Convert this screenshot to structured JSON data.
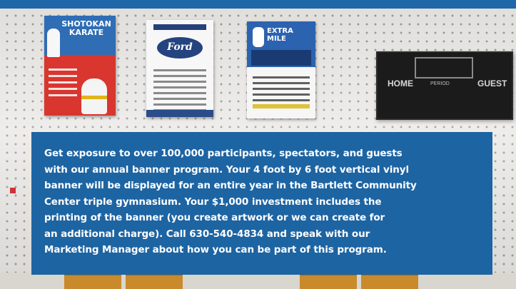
{
  "posters": {
    "karate": {
      "title_line1": "SHOTOKAN",
      "title_line2": "KARATE"
    },
    "ford": {
      "logo": "Ford"
    },
    "extra_mile": {
      "title_line1": "EXTRA",
      "title_line2": "MILE"
    }
  },
  "scoreboard": {
    "home": "HOME",
    "guest": "GUEST",
    "period": "PERIOD"
  },
  "info": {
    "lines": [
      "Get exposure to over 100,000 participants, spectators, and guests",
      "with our annual banner program. Your 4 foot by 6 foot vertical vinyl",
      "banner will be displayed for an entire year in the Bartlett Community",
      "Center triple gymnasium. Your $1,000 investment includes the",
      "printing of the banner (you create artwork or we can create for",
      "an additional charge). Call 630-540-4834 and speak with our",
      "Marketing Manager about how you can be part of this program."
    ]
  },
  "colors": {
    "accent_blue": "#1d64a3",
    "top_bar": "#1f67a8"
  }
}
